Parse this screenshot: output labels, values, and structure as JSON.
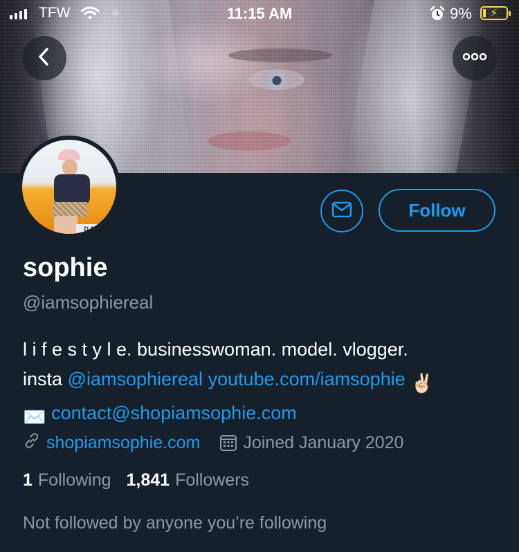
{
  "status_bar": {
    "carrier": "TFW",
    "time": "11:15 AM",
    "battery": "9%"
  },
  "header": {
    "back_icon": "chevron-left-icon",
    "more_icon": "more-horizontal-icon"
  },
  "profile": {
    "name": "sophie",
    "handle": "@iamsophiereal",
    "bio": {
      "line1": "l i f e s t y l e. businesswoman. model. vlogger.",
      "line2_prefix": "insta ",
      "line2_link1": "@iamsophiereal",
      "line2_link2": "youtube.com/iamsophie",
      "line2_emoji": "✌🏻",
      "line3_emoji": "✉️",
      "line3_link": "contact@shopiamsophie.com"
    },
    "website": "shopiamsophie.com",
    "joined": "Joined January 2020",
    "following_count": "1",
    "following_label": "Following",
    "followers_count": "1,841",
    "followers_label": "Followers",
    "not_followed_note": "Not followed by anyone you’re following",
    "avatar_plate": "D SPY"
  },
  "actions": {
    "follow_label": "Follow",
    "message_icon": "envelope-icon"
  },
  "colors": {
    "background": "#15202b",
    "accent": "#1d9bf0",
    "secondary_text": "#8b98a5"
  }
}
